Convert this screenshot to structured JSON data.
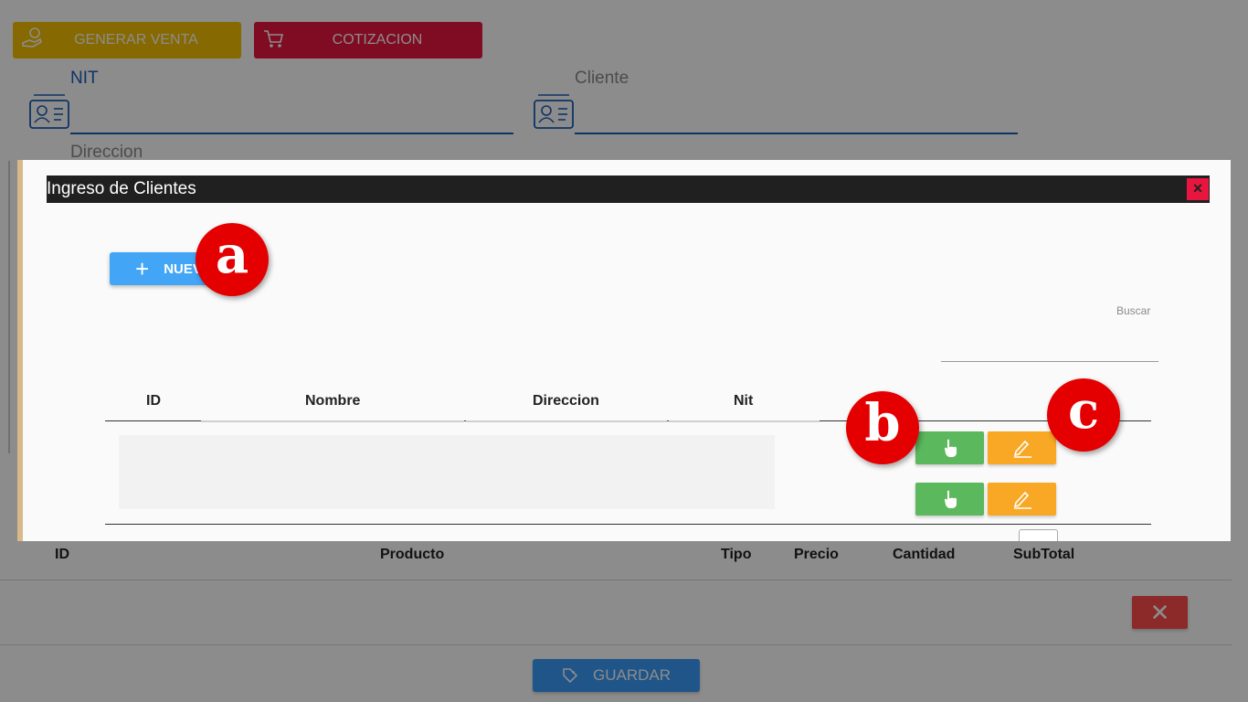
{
  "top_buttons": {
    "generar_venta": "GENERAR VENTA",
    "cotizacion": "COTIZACION"
  },
  "form": {
    "nit_label": "NIT",
    "cliente_label": "Cliente",
    "direccion_label": "Direccion"
  },
  "bg_table": {
    "columns": [
      "ID",
      "Producto",
      "Tipo",
      "Precio",
      "Cantidad",
      "SubTotal"
    ]
  },
  "bg_actions": {
    "delete_icon": "close-icon",
    "guardar_label": "GUARDAR"
  },
  "modal": {
    "title": "Ingreso de Clientes",
    "close_label": "×",
    "nuevo_label": "NUEVO",
    "buscar_label": "Buscar",
    "columns": [
      "ID",
      "Nombre",
      "Direccion",
      "Nit"
    ],
    "row_action_icons": [
      "pointer-hand-icon",
      "edit-pencil-icon"
    ]
  },
  "callouts": {
    "a": "a",
    "b": "b",
    "c": "c"
  },
  "colors": {
    "venta": "#f5c000",
    "cotizacion": "#e8163f",
    "primary": "#42a5f5",
    "select_green": "#5cb85c",
    "edit_orange": "#f9a825",
    "callout_red": "#e40000",
    "modal_header": "#202020"
  }
}
